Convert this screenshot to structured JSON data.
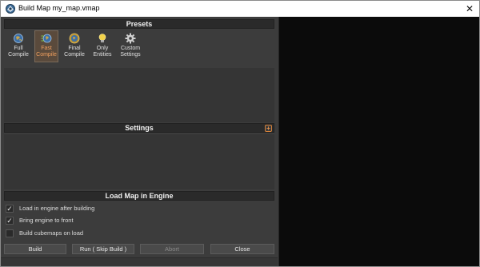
{
  "window": {
    "title": "Build Map my_map.vmap",
    "close_glyph": "✕"
  },
  "presets": {
    "header": "Presets",
    "items": [
      {
        "line1": "Full",
        "line2": "Compile",
        "icon": "globe-icon",
        "active": false
      },
      {
        "line1": "Fast",
        "line2": "Compile",
        "icon": "fast-compile-icon",
        "active": true
      },
      {
        "line1": "Final",
        "line2": "Compile",
        "icon": "globe-gold-icon",
        "active": false
      },
      {
        "line1": "Only",
        "line2": "Entities",
        "icon": "lightbulb-icon",
        "active": false
      },
      {
        "line1": "Custom",
        "line2": "Settings",
        "icon": "gear-icon",
        "active": false
      }
    ]
  },
  "settings": {
    "header": "Settings",
    "add_glyph": "+"
  },
  "load": {
    "header": "Load Map in Engine",
    "options": [
      {
        "label": "Load in engine after building",
        "checked": true
      },
      {
        "label": "Bring engine to front",
        "checked": true
      },
      {
        "label": "Build cubemaps on load",
        "checked": false
      }
    ]
  },
  "buttons": {
    "build": "Build",
    "run": "Run ( Skip Build )",
    "abort": "Abort",
    "close": "Close"
  },
  "colors": {
    "accent": "#e39150",
    "active_preset_bg": "#5a4a3c",
    "viewport": "#0b0b0b"
  }
}
